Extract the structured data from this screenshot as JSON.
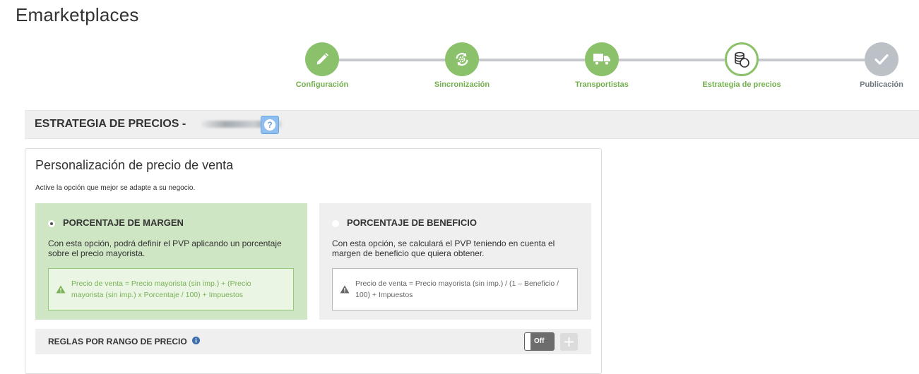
{
  "app": {
    "title": "Emarketplaces"
  },
  "wizard": {
    "steps": [
      {
        "label": "Configuración",
        "icon": "pencil-icon",
        "state": "done"
      },
      {
        "label": "Sincronización",
        "icon": "sync-gears-icon",
        "state": "done"
      },
      {
        "label": "Transportistas",
        "icon": "truck-icon",
        "state": "done"
      },
      {
        "label": "Estrategia de precios",
        "icon": "coins-icon",
        "state": "current"
      },
      {
        "label": "Publicación",
        "icon": "check-icon",
        "state": "pending"
      }
    ]
  },
  "section": {
    "title": "ESTRATEGIA DE PRECIOS -",
    "help_label": "?"
  },
  "panel": {
    "title": "Personalización de precio de venta",
    "subtitle": "Active la opción que mejor se adapte a su negocio.",
    "options": [
      {
        "title": "PORCENTAJE DE MARGEN",
        "selected": true,
        "description": "Con esta opción, podrá definir el PVP aplicando un porcentaje sobre el precio mayorista.",
        "formula": "Precio de venta = Precio mayorista (sin imp.) + (Precio mayorista (sin imp.) x Porcentaje / 100) + Impuestos"
      },
      {
        "title": "PORCENTAJE DE BENEFICIO",
        "selected": false,
        "description": "Con esta opción, se calculará el PVP teniendo en cuenta el margen de beneficio que quiera obtener.",
        "formula": "Precio de venta = Precio mayorista (sin imp.) / (1 – Beneficio / 100) + Impuestos"
      }
    ],
    "rules": {
      "title": "REGLAS POR RANGO DE PRECIO",
      "toggle_label": "Off"
    }
  },
  "colors": {
    "accent_green": "#8cc16b",
    "label_green": "#72b04d",
    "pending_gray": "#bcc1c7",
    "help_blue": "#8fbef0"
  }
}
